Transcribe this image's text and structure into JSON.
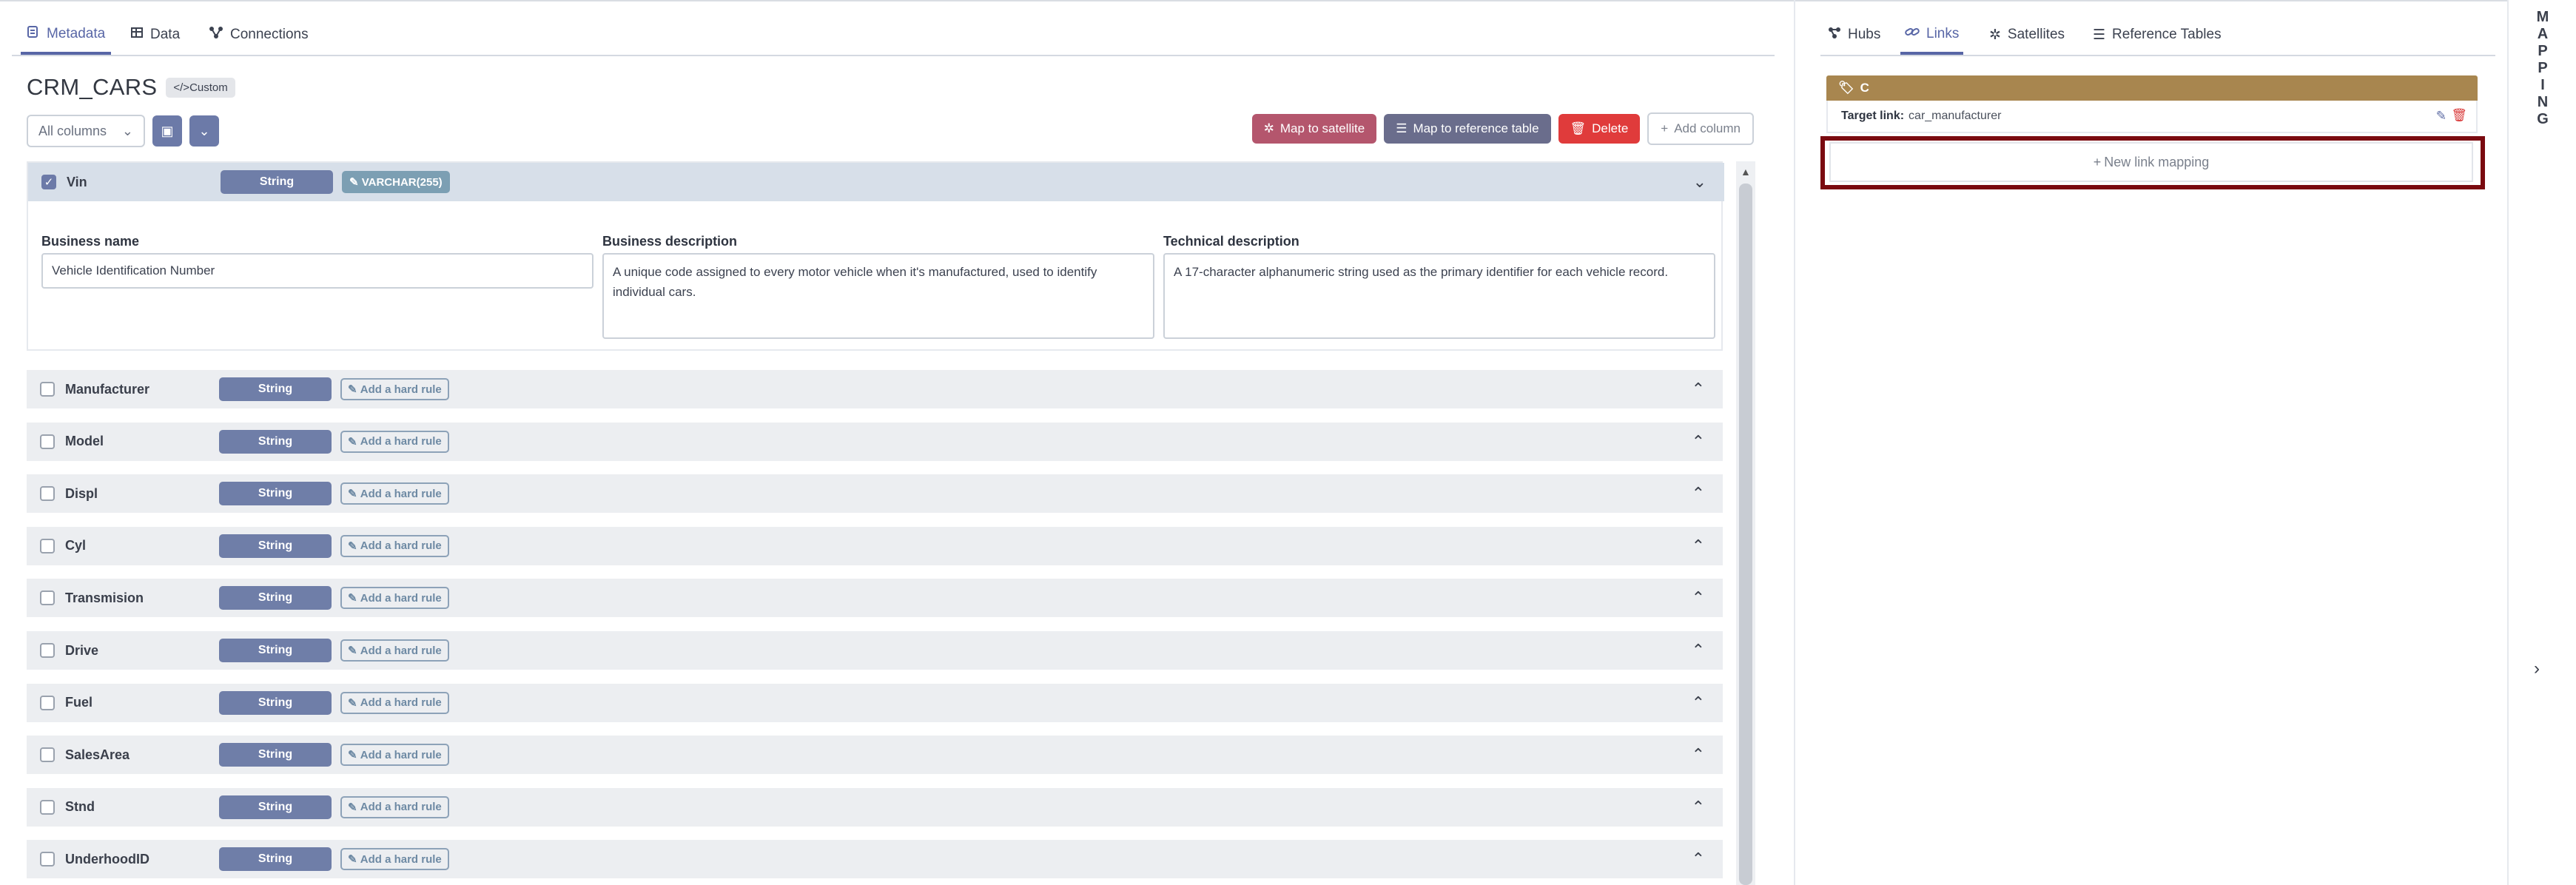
{
  "tabs": [
    {
      "label": "Metadata",
      "icon": "tag-list-icon",
      "active": true
    },
    {
      "label": "Data",
      "icon": "table-icon",
      "active": false
    },
    {
      "label": "Connections",
      "icon": "connections-icon",
      "active": false
    }
  ],
  "dataset": {
    "title": "CRM_CARS",
    "badge": "Custom",
    "badge_icon": "code-icon"
  },
  "filter": {
    "selected": "All columns"
  },
  "actions": {
    "map_satellite": "Map to satellite",
    "map_reference": "Map to reference table",
    "delete": "Delete",
    "add_column": "Add column"
  },
  "expanded_column": {
    "name": "Vin",
    "type": "String",
    "hard_rule": "VARCHAR(255)",
    "business_name_label": "Business name",
    "business_name_value": "Vehicle Identification Number",
    "business_description_label": "Business description",
    "business_description_value": "A unique code assigned to every motor vehicle when it's manufactured, used to identify individual cars.",
    "technical_description_label": "Technical description",
    "technical_description_value": "A 17-character alphanumeric string used as the primary identifier for each vehicle record."
  },
  "add_rule_label": "Add a hard rule",
  "columns": [
    {
      "name": "Manufacturer",
      "type": "String"
    },
    {
      "name": "Model",
      "type": "String"
    },
    {
      "name": "Displ",
      "type": "String"
    },
    {
      "name": "Cyl",
      "type": "String"
    },
    {
      "name": "Transmision",
      "type": "String"
    },
    {
      "name": "Drive",
      "type": "String"
    },
    {
      "name": "Fuel",
      "type": "String"
    },
    {
      "name": "SalesArea",
      "type": "String"
    },
    {
      "name": "Stnd",
      "type": "String"
    },
    {
      "name": "UnderhoodID",
      "type": "String"
    }
  ],
  "mapping": {
    "tabs": [
      {
        "label": "Hubs",
        "icon": "hub-icon",
        "active": false
      },
      {
        "label": "Links",
        "icon": "link-icon",
        "active": true
      },
      {
        "label": "Satellites",
        "icon": "satellite-icon",
        "active": false
      },
      {
        "label": "Reference Tables",
        "icon": "list-icon",
        "active": false
      }
    ],
    "card": {
      "title": "C",
      "target_label": "Target link:",
      "target_value": "car_manufacturer"
    },
    "new_link": "New link mapping",
    "side_label": "MAPPING"
  },
  "colors": {
    "accent": "#5866a6",
    "type_pill": "#6f7ea8",
    "satellite": "#b4566d",
    "reference": "#6a6d8c",
    "delete": "#e03b3b",
    "link_card": "#a8864f",
    "highlight": "#7a0a10"
  }
}
